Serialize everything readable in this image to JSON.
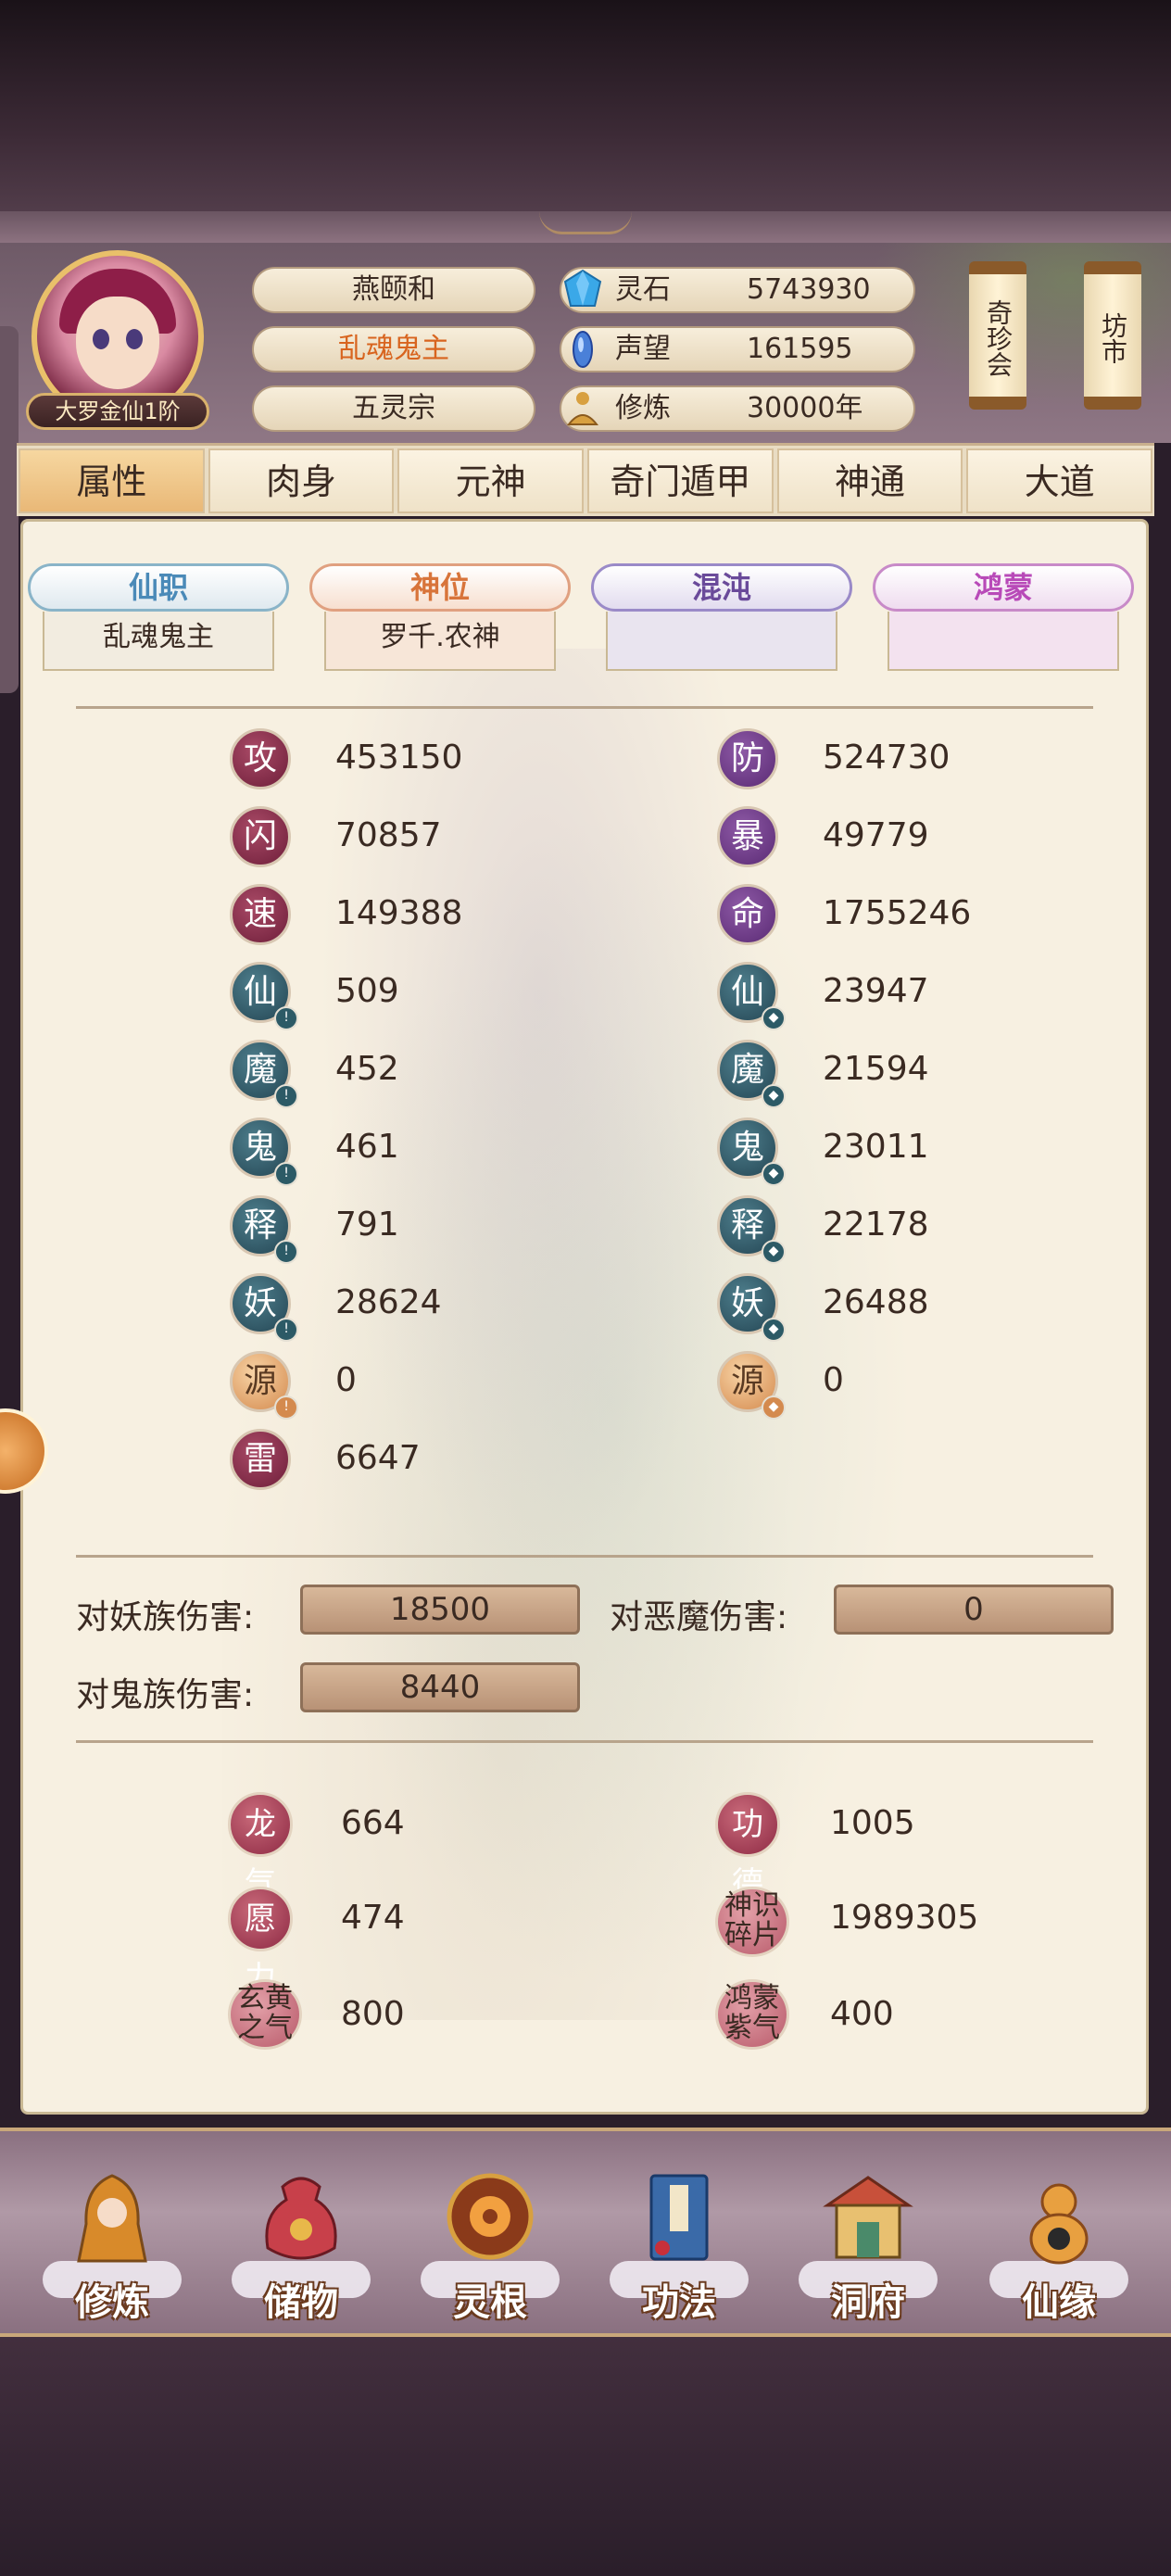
{
  "player": {
    "name": "燕颐和",
    "title": "乱魂鬼主",
    "sect": "五灵宗",
    "rank": "大罗金仙1阶"
  },
  "resources": [
    {
      "label": "灵石",
      "value": "5743930",
      "icon": "spirit-stone-icon",
      "color": "#3aa8e8"
    },
    {
      "label": "声望",
      "value": "161595",
      "icon": "prestige-crystal-icon",
      "color": "#4a80d8"
    },
    {
      "label": "修炼",
      "value": "30000年",
      "icon": "meditation-icon",
      "color": "#d8a040"
    }
  ],
  "side_buttons": [
    {
      "label": "奇珍会"
    },
    {
      "label": "坊市"
    }
  ],
  "tabs": [
    {
      "label": "属性",
      "active": true
    },
    {
      "label": "肉身",
      "active": false
    },
    {
      "label": "元神",
      "active": false
    },
    {
      "label": "奇门遁甲",
      "active": false
    },
    {
      "label": "神通",
      "active": false
    },
    {
      "label": "大道",
      "active": false
    }
  ],
  "sub_tabs": [
    {
      "label": "仙职",
      "value": "乱魂鬼主",
      "color": "#4a8ab8"
    },
    {
      "label": "神位",
      "value": "罗千.农神",
      "color": "#d8743a"
    },
    {
      "label": "混沌",
      "value": "",
      "color": "#6a4a9a"
    },
    {
      "label": "鸿蒙",
      "value": "",
      "color": "#b84ab8"
    }
  ],
  "stats_left": [
    {
      "label": "攻",
      "value": "453150",
      "style": "red",
      "marker": ""
    },
    {
      "label": "闪",
      "value": "70857",
      "style": "red",
      "marker": ""
    },
    {
      "label": "速",
      "value": "149388",
      "style": "red",
      "marker": ""
    },
    {
      "label": "仙",
      "value": "509",
      "style": "teal",
      "marker": "!"
    },
    {
      "label": "魔",
      "value": "452",
      "style": "teal",
      "marker": "!"
    },
    {
      "label": "鬼",
      "value": "461",
      "style": "teal",
      "marker": "!"
    },
    {
      "label": "释",
      "value": "791",
      "style": "teal",
      "marker": "!"
    },
    {
      "label": "妖",
      "value": "28624",
      "style": "teal",
      "marker": "!"
    },
    {
      "label": "源",
      "value": "0",
      "style": "orange",
      "marker": "!"
    },
    {
      "label": "雷",
      "value": "6647",
      "style": "red",
      "marker": ""
    }
  ],
  "stats_right": [
    {
      "label": "防",
      "value": "524730",
      "style": "purple",
      "marker": ""
    },
    {
      "label": "暴",
      "value": "49779",
      "style": "purple",
      "marker": ""
    },
    {
      "label": "命",
      "value": "1755246",
      "style": "purple",
      "marker": ""
    },
    {
      "label": "仙",
      "value": "23947",
      "style": "teal",
      "marker": "◆"
    },
    {
      "label": "魔",
      "value": "21594",
      "style": "teal",
      "marker": "◆"
    },
    {
      "label": "鬼",
      "value": "23011",
      "style": "teal",
      "marker": "◆"
    },
    {
      "label": "释",
      "value": "22178",
      "style": "teal",
      "marker": "◆"
    },
    {
      "label": "妖",
      "value": "26488",
      "style": "teal",
      "marker": "◆"
    },
    {
      "label": "源",
      "value": "0",
      "style": "orange",
      "marker": "◆"
    }
  ],
  "damage": [
    {
      "label": "对妖族伤害:",
      "value": "18500"
    },
    {
      "label": "对恶魔伤害:",
      "value": "0"
    },
    {
      "label": "对鬼族伤害:",
      "value": "8440"
    }
  ],
  "extras": [
    {
      "label": "龙气",
      "value": "664"
    },
    {
      "label": "功德",
      "value": "1005"
    },
    {
      "label": "愿力",
      "value": "474"
    },
    {
      "label": "神识碎片",
      "value": "1989305"
    },
    {
      "label": "玄黄之气",
      "value": "800"
    },
    {
      "label": "鸿蒙紫气",
      "value": "400"
    }
  ],
  "bottom_nav": [
    {
      "label": "修炼",
      "icon": "cultivation-icon"
    },
    {
      "label": "储物",
      "icon": "storage-bag-icon"
    },
    {
      "label": "灵根",
      "icon": "spirit-root-icon"
    },
    {
      "label": "功法",
      "icon": "technique-book-icon"
    },
    {
      "label": "洞府",
      "icon": "cave-dwelling-icon"
    },
    {
      "label": "仙缘",
      "icon": "immortal-fate-icon"
    }
  ]
}
